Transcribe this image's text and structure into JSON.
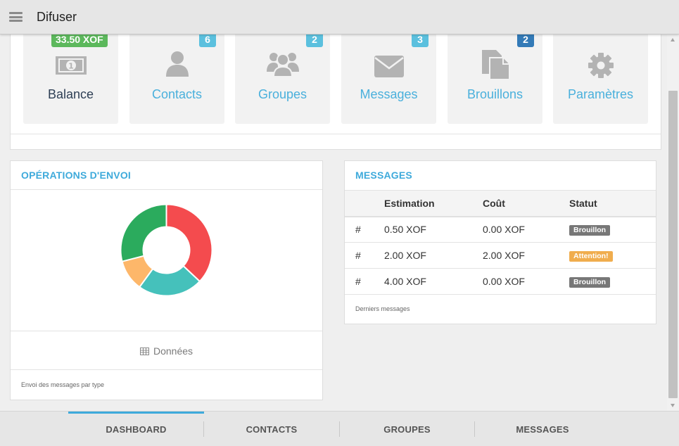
{
  "app": {
    "title": "Difuser"
  },
  "tiles": [
    {
      "key": "balance",
      "label": "Balance",
      "badge": "33.50 XOF",
      "badge_color": "#5cb85c",
      "icon": "money-icon"
    },
    {
      "key": "contacts",
      "label": "Contacts",
      "badge": "6",
      "badge_color": "#5bc0de",
      "icon": "user-icon"
    },
    {
      "key": "groupes",
      "label": "Groupes",
      "badge": "2",
      "badge_color": "#5bc0de",
      "icon": "users-icon"
    },
    {
      "key": "messages",
      "label": "Messages",
      "badge": "3",
      "badge_color": "#5bc0de",
      "icon": "envelope-icon"
    },
    {
      "key": "brouillons",
      "label": "Brouillons",
      "badge": "2",
      "badge_color": "#337ab7",
      "icon": "files-icon"
    },
    {
      "key": "parametres",
      "label": "Paramètres",
      "badge": "",
      "badge_color": "",
      "icon": "gear-icon"
    }
  ],
  "operations": {
    "title": "OPÉRATIONS D'ENVOI",
    "donnees_label": "Données",
    "footnote": "Envoi des messages par type",
    "chart_data": {
      "type": "pie",
      "donut": true,
      "slices": [
        {
          "value": 37,
          "color": "#f44b4e"
        },
        {
          "value": 23,
          "color": "#45c1bb"
        },
        {
          "value": 11,
          "color": "#fdb76a"
        },
        {
          "value": 29,
          "color": "#2bab5d"
        }
      ]
    }
  },
  "messages": {
    "title": "MESSAGES",
    "headers": [
      "",
      "Estimation",
      "Coût",
      "Statut"
    ],
    "rows": [
      {
        "id": "#",
        "estimation": "0.50 XOF",
        "cout": "0.00 XOF",
        "statut": "Brouillon",
        "statut_color": "#777777"
      },
      {
        "id": "#",
        "estimation": "2.00 XOF",
        "cout": "2.00 XOF",
        "statut": "Attention!",
        "statut_color": "#f0ad4e"
      },
      {
        "id": "#",
        "estimation": "4.00 XOF",
        "cout": "0.00 XOF",
        "statut": "Brouillon",
        "statut_color": "#777777"
      }
    ],
    "footnote": "Derniers messages"
  },
  "bottom_nav": [
    {
      "label": "DASHBOARD",
      "active": true
    },
    {
      "label": "CONTACTS",
      "active": false
    },
    {
      "label": "GROUPES",
      "active": false
    },
    {
      "label": "MESSAGES",
      "active": false
    }
  ]
}
